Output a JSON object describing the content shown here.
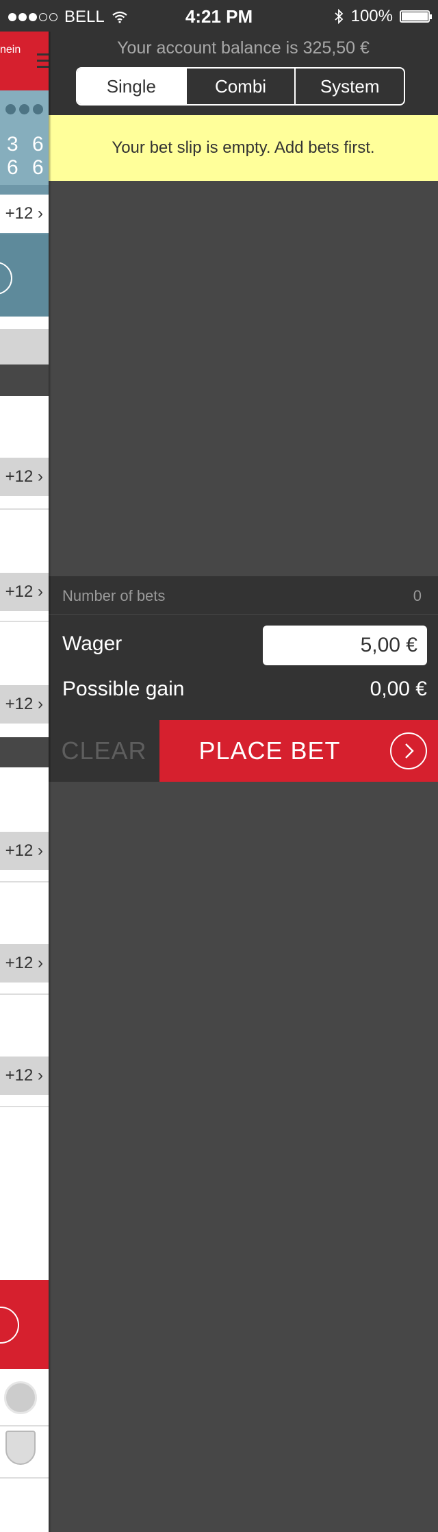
{
  "status_bar": {
    "carrier": "BELL",
    "time": "4:21 PM",
    "battery": "100%",
    "icons": [
      "signal-dots-icon",
      "wifi-icon",
      "bluetooth-icon",
      "battery-icon"
    ]
  },
  "background_app": {
    "header_text": "nein",
    "scores": [
      "3 6",
      "6 6"
    ],
    "more_label": "+12"
  },
  "bet_slip": {
    "balance_text": "Your account balance is 325,50 €",
    "tabs": [
      {
        "label": "Single",
        "active": true
      },
      {
        "label": "Combi",
        "active": false
      },
      {
        "label": "System",
        "active": false
      }
    ],
    "empty_notice": "Your bet slip is empty. Add bets first.",
    "summary": {
      "count_label": "Number of bets",
      "count_value": "0",
      "wager_label": "Wager",
      "wager_value": "5,00 €",
      "gain_label": "Possible gain",
      "gain_value": "0,00 €"
    },
    "actions": {
      "clear_label": "CLEAR",
      "place_label": "PLACE BET"
    }
  },
  "colors": {
    "brand_red": "#d6202e",
    "notice_yellow": "#ffff9a",
    "panel_dark": "#333333",
    "panel_bg": "#474747"
  }
}
